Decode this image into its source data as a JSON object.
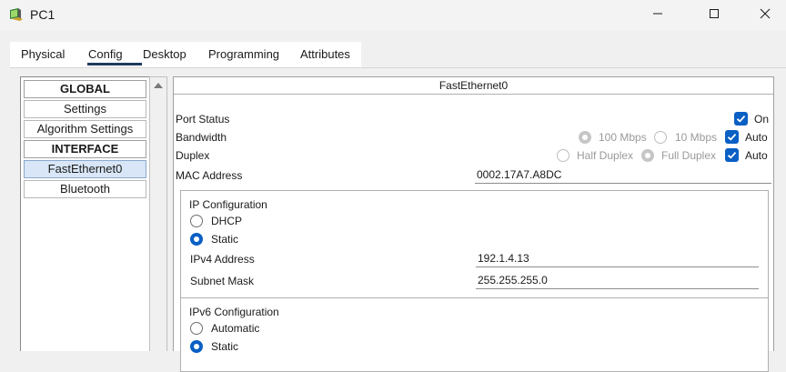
{
  "window": {
    "title": "PC1"
  },
  "tabs": [
    "Physical",
    "Config",
    "Desktop",
    "Programming",
    "Attributes"
  ],
  "sidebar": {
    "items": [
      {
        "label": "GLOBAL"
      },
      {
        "label": "Settings"
      },
      {
        "label": "Algorithm Settings"
      },
      {
        "label": "INTERFACE"
      },
      {
        "label": "FastEthernet0"
      },
      {
        "label": "Bluetooth"
      }
    ]
  },
  "panel": {
    "title": "FastEthernet0",
    "port_status": {
      "label": "Port Status",
      "on_label": "On",
      "checked": true
    },
    "bandwidth": {
      "label": "Bandwidth",
      "opt1": "100 Mbps",
      "opt2": "10 Mbps",
      "auto_label": "Auto"
    },
    "duplex": {
      "label": "Duplex",
      "opt1": "Half Duplex",
      "opt2": "Full Duplex",
      "auto_label": "Auto"
    },
    "mac": {
      "label": "MAC Address",
      "value": "0002.17A7.A8DC"
    },
    "ipv4_config": {
      "title": "IP Configuration",
      "dhcp_label": "DHCP",
      "static_label": "Static",
      "mode": "Static",
      "address_label": "IPv4 Address",
      "address_value": "192.1.4.13",
      "mask_label": "Subnet Mask",
      "mask_value": "255.255.255.0"
    },
    "ipv6_config": {
      "title": "IPv6 Configuration",
      "automatic_label": "Automatic",
      "static_label": "Static",
      "mode": "Static"
    }
  },
  "colors": {
    "accent": "#0a5fc4",
    "selected_nav": "#d8e6f7",
    "tab_underline": "#1f3a5f"
  }
}
